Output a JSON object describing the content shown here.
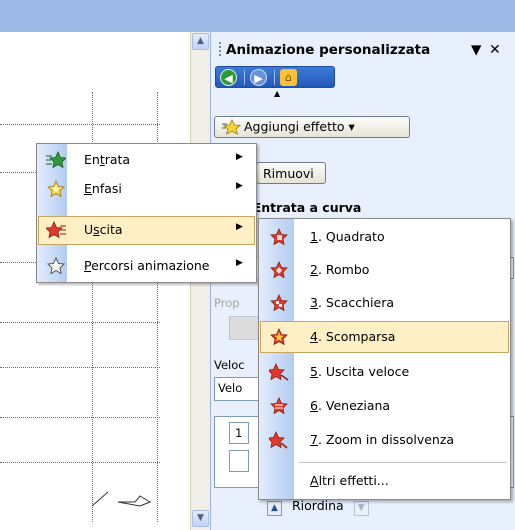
{
  "task_pane": {
    "title": "Animazione personalizzata",
    "add_effect": "Aggiungi effetto",
    "remove": "Rimuovi",
    "modify_label": "ifica: Entrata a curva",
    "property_label": "Prop",
    "speed_label": "Veloc",
    "speed_value": "Velo",
    "list_number": "1",
    "reorder_label": "Riordina"
  },
  "main_menu": {
    "items": [
      {
        "pre": "En",
        "accel": "t",
        "post": "rata",
        "icon": "entrance-star-icon"
      },
      {
        "pre": "",
        "accel": "E",
        "post": "nfasi",
        "icon": "emphasis-star-icon"
      },
      {
        "pre": "U",
        "accel": "s",
        "post": "cita",
        "icon": "exit-star-icon"
      },
      {
        "pre": "",
        "accel": "P",
        "post": "ercorsi animazione",
        "icon": "motion-path-star-icon"
      }
    ],
    "active_index": 2
  },
  "submenu": {
    "items": [
      {
        "accel": "1",
        "post": ". Quadrato"
      },
      {
        "accel": "2",
        "post": ". Rombo"
      },
      {
        "accel": "3",
        "post": ". Scacchiera"
      },
      {
        "accel": "4",
        "post": ". Scomparsa"
      },
      {
        "accel": "5",
        "post": ". Uscita veloce"
      },
      {
        "accel": "6",
        "post": ". Veneziana"
      },
      {
        "accel": "7",
        "post": ". Zoom in dissolvenza"
      }
    ],
    "active_index": 3,
    "more": {
      "accel": "A",
      "post": "ltri effetti..."
    }
  },
  "colors": {
    "highlight": "#ffefc5",
    "highlight_border": "#c9a660",
    "pane_bg": "#e8f0fd",
    "gutter": "#b3cbf2"
  }
}
